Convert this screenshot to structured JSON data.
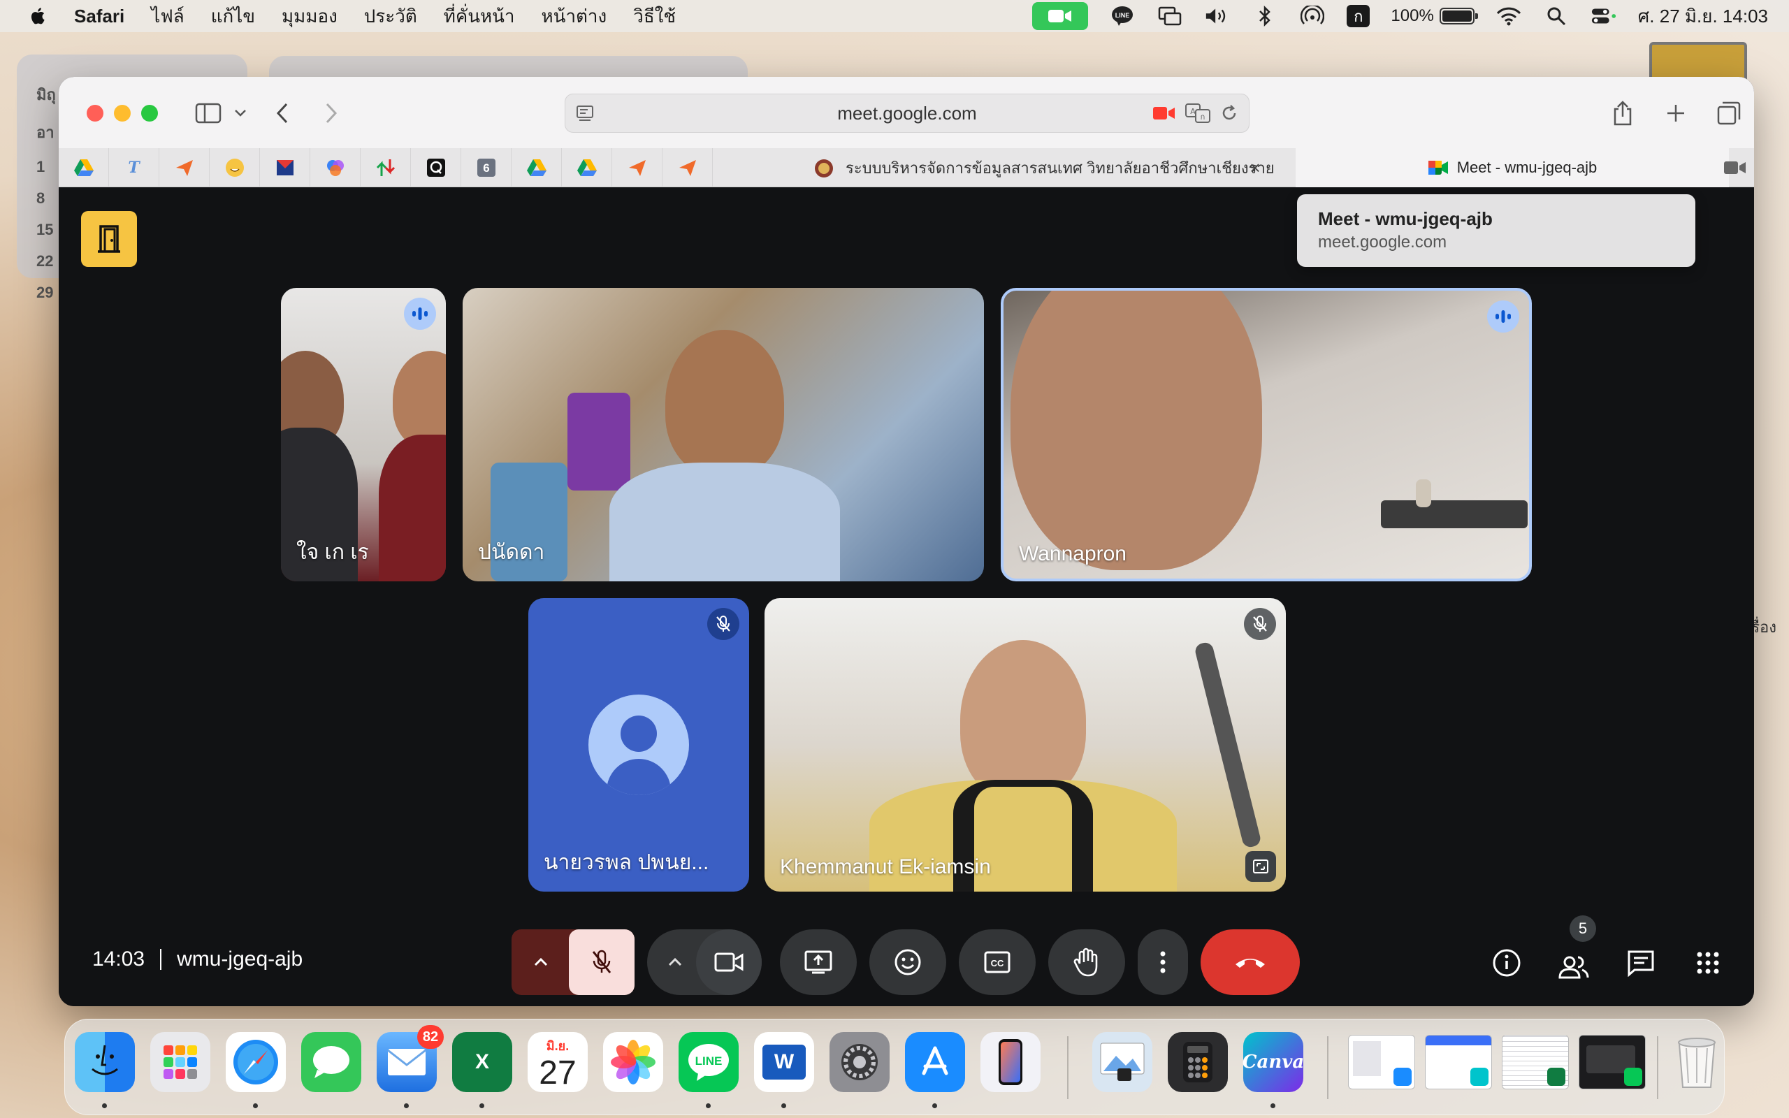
{
  "menubar": {
    "app_name": "Safari",
    "items": [
      "ไฟล์",
      "แก้ไข",
      "มุมมอง",
      "ประวัติ",
      "ที่คั่นหน้า",
      "หน้าต่าง",
      "วิธีใช้"
    ],
    "input_source": "ก",
    "battery": "100%",
    "clock": "ศ. 27 มิ.ย.  14:03"
  },
  "background": {
    "calendar_days": [
      "มิถุ",
      "อา",
      "1",
      "8",
      "15",
      "22",
      "29"
    ],
    "side_text": "เรื่อง"
  },
  "browser": {
    "url": "meet.google.com",
    "pinned_tabs": [
      "Drive",
      "T",
      "Feather",
      "Emoji",
      "M",
      "Copilot",
      "Stack",
      "Q",
      "6",
      "Drive",
      "Drive",
      "Feather",
      "Feather"
    ],
    "inactive_tab": "ระบบบริหารจัดการข้อมูลสารสนเทศ วิทยาลัยอาชีวศึกษาเชียงราย",
    "active_tab": "Meet - wmu-jgeq-ajb",
    "tooltip": {
      "title": "Meet - wmu-jgeq-ajb",
      "url": "meet.google.com"
    }
  },
  "meet": {
    "participants": [
      {
        "name": "ใจ เก เร",
        "state": "speaking"
      },
      {
        "name": "ปนัดดา",
        "state": "none"
      },
      {
        "name": "Wannapron",
        "state": "speaking"
      },
      {
        "name": "นายวรพล ปพนย...",
        "state": "muted"
      },
      {
        "name": "Khemmanut Ek-iamsin",
        "state": "muted"
      }
    ],
    "time": "14:03",
    "meeting_code": "wmu-jgeq-ajb",
    "people_count": "5"
  },
  "dock": {
    "mail_badge": "82",
    "calendar_month": "มิ.ย.",
    "calendar_day": "27",
    "apps": [
      "Finder",
      "Launchpad",
      "Safari",
      "Messages",
      "Mail",
      "Excel",
      "Calendar",
      "Photos",
      "LINE",
      "Word",
      "System Settings",
      "App Store",
      "iPhone Mirroring",
      "Preview",
      "Calculator",
      "Canva"
    ],
    "canva_label": "Canva",
    "excel_label": "X",
    "word_label": "W",
    "line_label": "LINE"
  },
  "colors": {
    "meet_bg": "#111214",
    "speaking_ring": "#aecbfa",
    "end_call": "#dc362e",
    "mic_off_bg": "#f9dedc",
    "door_button": "#f6c442"
  }
}
